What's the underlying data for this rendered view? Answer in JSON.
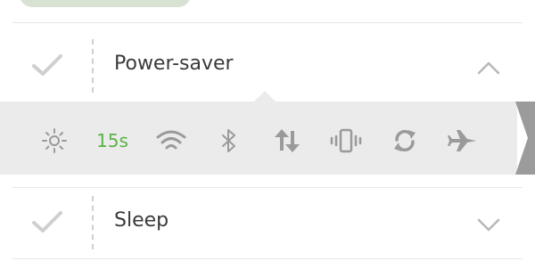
{
  "items": [
    {
      "label": "Power-saver",
      "expanded": true
    },
    {
      "label": "Sleep",
      "expanded": false
    }
  ],
  "quick_settings": {
    "timeout": "15s",
    "icons": [
      "brightness-icon",
      "timeout",
      "wifi-icon",
      "bluetooth-icon",
      "data-icon",
      "vibrate-icon",
      "sync-icon",
      "airplane-icon"
    ]
  },
  "colors": {
    "accent_green": "#58b349",
    "drawer_bg": "#ebebeb",
    "icon_gray": "#9a9a9a"
  }
}
